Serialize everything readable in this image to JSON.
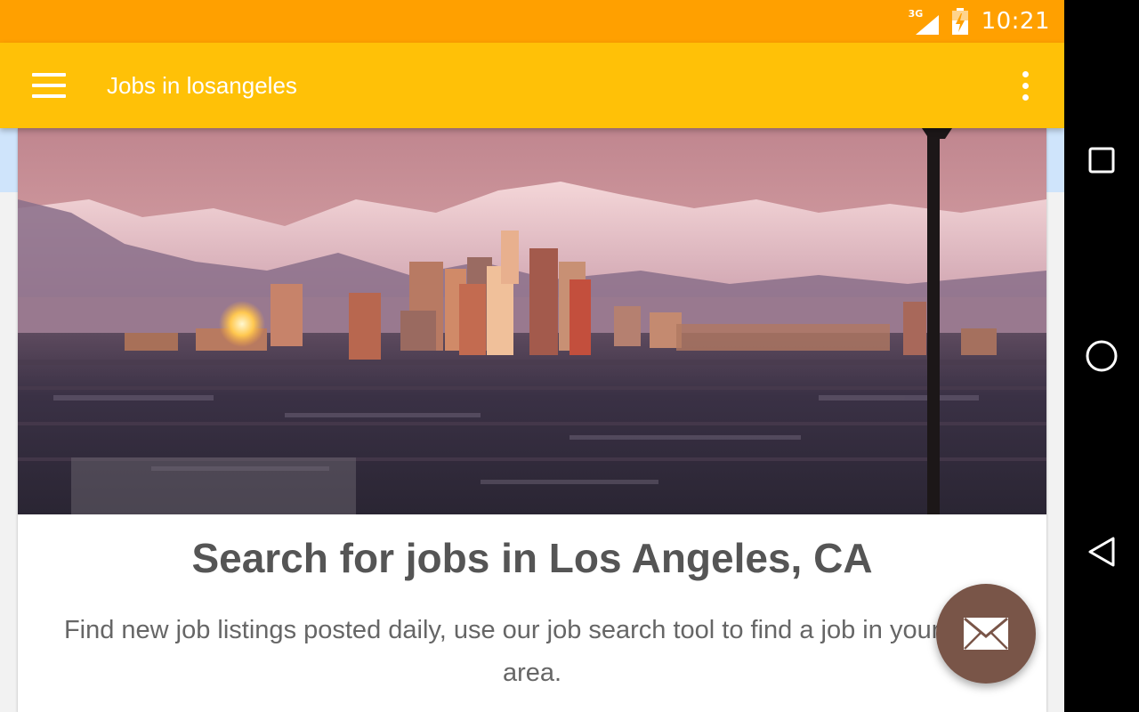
{
  "status_bar": {
    "network": "3G",
    "time": "10:21"
  },
  "app_bar": {
    "title": "Jobs in losangeles"
  },
  "hero": {
    "title": "Search for jobs in Los Angeles, CA",
    "description": "Find new job listings posted daily, use our job search tool to find a job in your local area."
  },
  "icons": {
    "menu": "menu-icon",
    "overflow": "more-vert-icon",
    "fab": "mail-icon",
    "signal": "signal-icon",
    "battery": "battery-charging-icon",
    "recents": "recents-square-icon",
    "home": "home-circle-icon",
    "back": "back-triangle-icon"
  },
  "colors": {
    "status_bar": "#ffa000",
    "app_bar": "#ffc107",
    "fab": "#795548",
    "nav_bar": "#000000"
  }
}
